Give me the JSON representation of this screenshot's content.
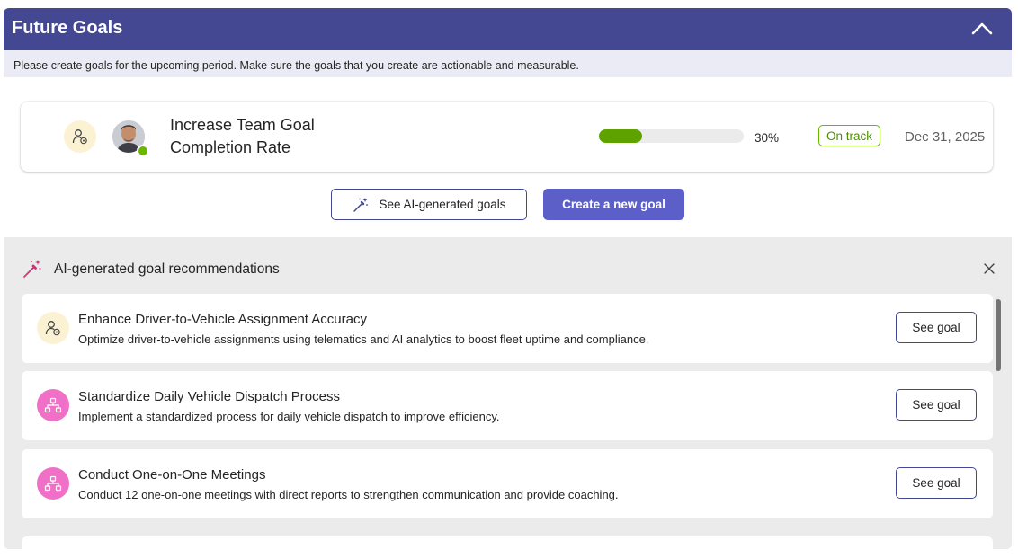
{
  "header": {
    "title": "Future Goals",
    "collapse_icon": "chevron-up-icon"
  },
  "subheader": {
    "text": "Please create goals for the upcoming period. Make sure the goals that you create are actionable and measurable."
  },
  "goal": {
    "type_icon": "person-target-icon",
    "title": "Increase Team Goal Completion Rate",
    "progress": 30,
    "progress_label": "30%",
    "progress_color": "#5ea200",
    "status": "On track",
    "status_color": "#6bb700",
    "due_date": "Dec 31, 2025"
  },
  "actions": {
    "ai_button_label": "See AI-generated goals",
    "ai_button_icon": "magic-wand-icon",
    "create_button_label": "Create a new goal",
    "accent": "#5b5fc7",
    "brand": "#444791"
  },
  "recommendations": {
    "title": "AI-generated goal recommendations",
    "header_icon": "magic-wand-icon",
    "close_icon": "close-icon",
    "items": [
      {
        "icon": "person-target-icon",
        "name": "Enhance Driver-to-Vehicle Assignment Accuracy",
        "description": "Optimize driver-to-vehicle assignments using telematics and AI analytics to boost fleet uptime and compliance.",
        "button_label": "See goal"
      },
      {
        "icon": "org-chart-icon",
        "name": "Standardize Daily Vehicle Dispatch Process",
        "description": "Implement a standardized process for daily vehicle dispatch to improve efficiency.",
        "button_label": "See goal"
      },
      {
        "icon": "org-chart-icon",
        "name": "Conduct One-on-One Meetings",
        "description": "Conduct 12 one-on-one meetings with direct reports to strengthen communication and provide coaching.",
        "button_label": "See goal"
      }
    ]
  }
}
